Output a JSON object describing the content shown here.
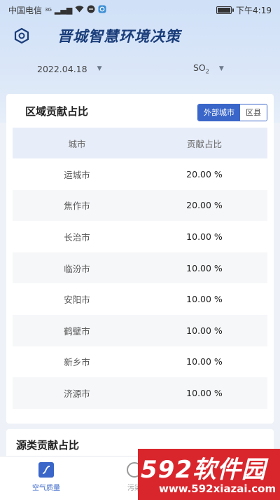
{
  "status_bar": {
    "carrier": "中国电信",
    "network": "3G",
    "time": "下午4:19"
  },
  "header": {
    "title": "晋城智慧环境决策",
    "menu_icon": "hexagon-icon"
  },
  "filters": {
    "date": "2022.04.18",
    "pollutant": "SO",
    "pollutant_sub": "2"
  },
  "region_card": {
    "title": "区域贡献占比",
    "tabs": [
      {
        "label": "外部城市",
        "active": true
      },
      {
        "label": "区县",
        "active": false
      }
    ],
    "columns": [
      "城市",
      "贡献占比"
    ],
    "rows": [
      {
        "city": "运城市",
        "share": "20.00 %"
      },
      {
        "city": "焦作市",
        "share": "20.00 %"
      },
      {
        "city": "长治市",
        "share": "10.00 %"
      },
      {
        "city": "临汾市",
        "share": "10.00 %"
      },
      {
        "city": "安阳市",
        "share": "10.00 %"
      },
      {
        "city": "鹤壁市",
        "share": "10.00 %"
      },
      {
        "city": "新乡市",
        "share": "10.00 %"
      },
      {
        "city": "济源市",
        "share": "10.00 %"
      }
    ]
  },
  "source_card": {
    "title": "源类贡献占比"
  },
  "bottom_nav": {
    "items": [
      {
        "label": "空气质量",
        "active": true
      },
      {
        "label": "污染",
        "active": false
      }
    ]
  },
  "watermark": {
    "brand": "592软件园",
    "url": "www.592xiazai.com"
  },
  "colors": {
    "accent": "#3a66c9",
    "title_blue": "#1a3d7a",
    "watermark_red": "#d9262c"
  }
}
